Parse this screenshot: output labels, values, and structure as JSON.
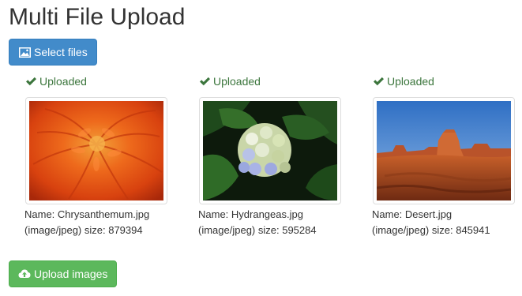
{
  "page": {
    "title": "Multi File Upload"
  },
  "toolbar": {
    "select_label": "Select files",
    "upload_label": "Upload images"
  },
  "files": [
    {
      "status": "Uploaded",
      "name_line": "Name: Chrysanthemum.jpg",
      "info_line": "(image/jpeg) size: 879394",
      "thumb_icon": "chrysanthemum-image"
    },
    {
      "status": "Uploaded",
      "name_line": "Name: Hydrangeas.jpg",
      "info_line": "(image/jpeg) size: 595284",
      "thumb_icon": "hydrangeas-image"
    },
    {
      "status": "Uploaded",
      "name_line": "Name: Desert.jpg",
      "info_line": "(image/jpeg) size: 845941",
      "thumb_icon": "desert-image"
    }
  ],
  "colors": {
    "primary": "#428bca",
    "success": "#5cb85c",
    "status_text": "#3c763d"
  },
  "icons": {
    "select": "picture-icon",
    "upload": "cloud-upload-icon",
    "status": "check-icon"
  }
}
